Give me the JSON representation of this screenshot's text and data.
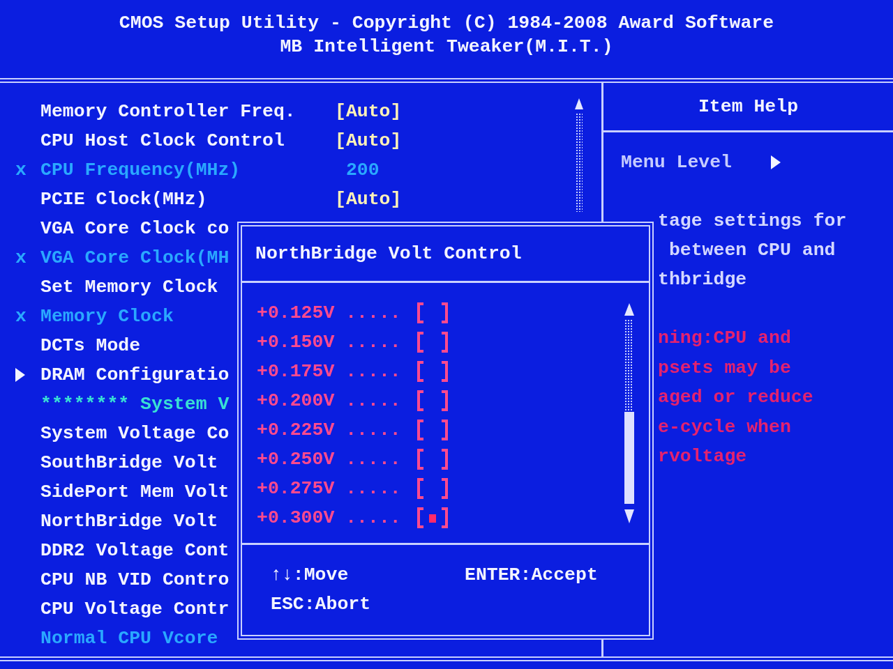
{
  "header": {
    "title": "CMOS Setup Utility - Copyright (C) 1984-2008 Award Software",
    "subtitle": "MB Intelligent Tweaker(M.I.T.)"
  },
  "settings": [
    {
      "kind": "setting",
      "label": "Memory Controller Freq.",
      "value": "[Auto]"
    },
    {
      "kind": "setting",
      "label": "CPU Host Clock Control",
      "value": "[Auto]"
    },
    {
      "kind": "disabled",
      "marker": "x",
      "label": "CPU Frequency(MHz)",
      "value": "200"
    },
    {
      "kind": "setting",
      "label": "PCIE Clock(MHz)",
      "value": "[Auto]"
    },
    {
      "kind": "setting",
      "label": "VGA Core Clock co"
    },
    {
      "kind": "disabled",
      "marker": "x",
      "label": "VGA Core Clock(MH"
    },
    {
      "kind": "setting",
      "label": "Set Memory Clock"
    },
    {
      "kind": "disabled",
      "marker": "x",
      "label": "Memory Clock"
    },
    {
      "kind": "setting",
      "label": "DCTs Mode"
    },
    {
      "kind": "submenu",
      "label": "DRAM Configuratio"
    },
    {
      "kind": "heading",
      "label": "******** System V"
    },
    {
      "kind": "setting",
      "label": "System Voltage Co"
    },
    {
      "kind": "setting",
      "label": "SouthBridge Volt"
    },
    {
      "kind": "setting",
      "label": "SidePort Mem Volt"
    },
    {
      "kind": "setting",
      "label": "NorthBridge Volt"
    },
    {
      "kind": "setting",
      "label": "DDR2 Voltage Cont"
    },
    {
      "kind": "setting",
      "label": "CPU NB VID Contro"
    },
    {
      "kind": "setting",
      "label": "CPU Voltage Contr"
    },
    {
      "kind": "info",
      "label": "Normal CPU Vcore"
    }
  ],
  "item_help": {
    "title": "Item Help",
    "menu_level": "Menu Level",
    "description": [
      "tage settings for",
      " between CPU and",
      "thbridge"
    ],
    "warning": [
      "ning:CPU and",
      "psets may be",
      "aged or reduce",
      "e-cycle when",
      "rvoltage"
    ]
  },
  "dialog": {
    "title": "NorthBridge Volt Control",
    "options": [
      {
        "label": "+0.125V .....",
        "selected": false
      },
      {
        "label": "+0.150V .....",
        "selected": false
      },
      {
        "label": "+0.175V .....",
        "selected": false
      },
      {
        "label": "+0.200V .....",
        "selected": false
      },
      {
        "label": "+0.225V .....",
        "selected": false
      },
      {
        "label": "+0.250V .....",
        "selected": false
      },
      {
        "label": "+0.275V .....",
        "selected": false
      },
      {
        "label": "+0.300V .....",
        "selected": true
      }
    ],
    "hints": [
      "↑↓:Move",
      "ENTER:Accept",
      "ESC:Abort"
    ]
  }
}
